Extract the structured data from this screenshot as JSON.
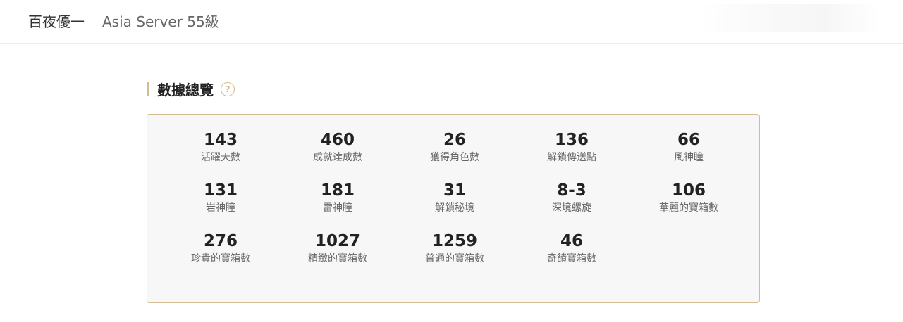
{
  "header": {
    "player_name": "百夜優一",
    "server_info": "Asia Server 55級"
  },
  "section": {
    "title": "數據總覽",
    "help_icon": "question-circle-icon",
    "help_glyph": "?"
  },
  "colors": {
    "accent": "#d3bc8e",
    "card_background": "#f7f7f7"
  },
  "stats": [
    {
      "value": "143",
      "label": "活躍天數"
    },
    {
      "value": "460",
      "label": "成就達成數"
    },
    {
      "value": "26",
      "label": "獲得角色數"
    },
    {
      "value": "136",
      "label": "解鎖傳送點"
    },
    {
      "value": "66",
      "label": "風神瞳"
    },
    {
      "value": "131",
      "label": "岩神瞳"
    },
    {
      "value": "181",
      "label": "雷神瞳"
    },
    {
      "value": "31",
      "label": "解鎖秘境"
    },
    {
      "value": "8-3",
      "label": "深境螺旋"
    },
    {
      "value": "106",
      "label": "華麗的寶箱數"
    },
    {
      "value": "276",
      "label": "珍貴的寶箱數"
    },
    {
      "value": "1027",
      "label": "精緻的寶箱數"
    },
    {
      "value": "1259",
      "label": "普通的寶箱數"
    },
    {
      "value": "46",
      "label": "奇饋寶箱數"
    }
  ]
}
